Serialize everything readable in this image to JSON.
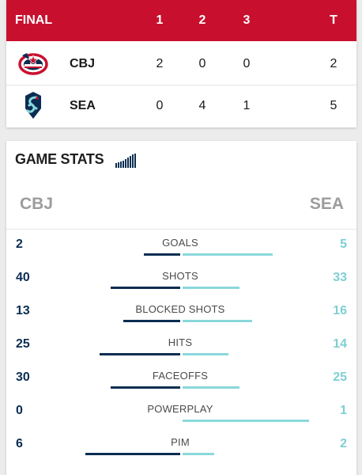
{
  "scoreboard": {
    "status": "FINAL",
    "periods": [
      "1",
      "2",
      "3"
    ],
    "total_label": "T",
    "teams": [
      {
        "abbr": "CBJ",
        "logo": "blue-jackets-logo",
        "periods": [
          "2",
          "0",
          "0"
        ],
        "total": "2"
      },
      {
        "abbr": "SEA",
        "logo": "kraken-logo",
        "periods": [
          "0",
          "4",
          "1"
        ],
        "total": "5"
      }
    ]
  },
  "game_stats": {
    "title": "GAME STATS",
    "icon": "signal-bars-icon",
    "home_abbr": "CBJ",
    "away_abbr": "SEA",
    "colors": {
      "left": "#0b2d52",
      "right": "#8ad8db"
    },
    "stats": [
      {
        "label": "GOALS",
        "left": "2",
        "right": "5",
        "left_share": 0.29,
        "right_share": 0.71
      },
      {
        "label": "SHOTS",
        "left": "40",
        "right": "33",
        "left_share": 0.55,
        "right_share": 0.45
      },
      {
        "label": "BLOCKED SHOTS",
        "left": "13",
        "right": "16",
        "left_share": 0.45,
        "right_share": 0.55
      },
      {
        "label": "HITS",
        "left": "25",
        "right": "14",
        "left_share": 0.64,
        "right_share": 0.36
      },
      {
        "label": "FACEOFFS",
        "left": "30",
        "right": "25",
        "left_share": 0.55,
        "right_share": 0.45
      },
      {
        "label": "POWERPLAY",
        "left": "0",
        "right": "1",
        "left_share": 0.0,
        "right_share": 1.0
      },
      {
        "label": "PIM",
        "left": "6",
        "right": "2",
        "left_share": 0.75,
        "right_share": 0.25
      }
    ]
  }
}
